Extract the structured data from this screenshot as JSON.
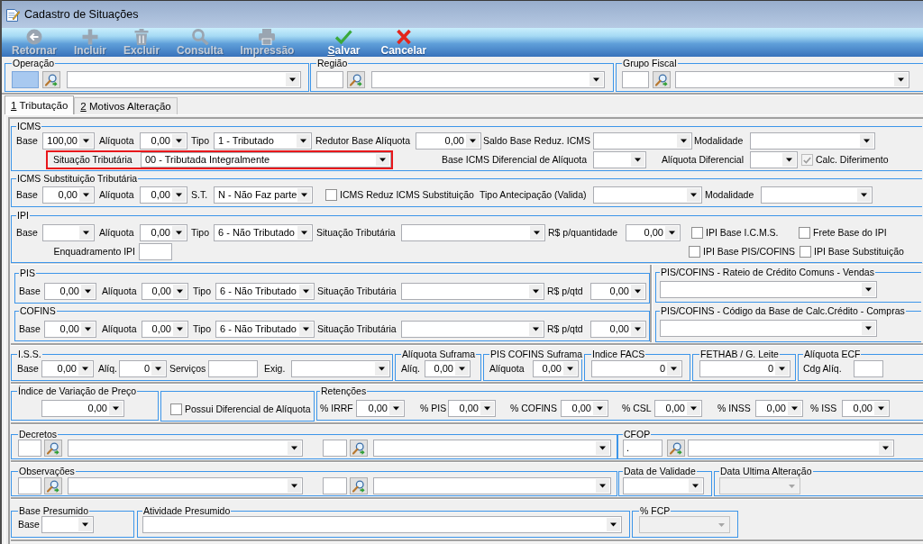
{
  "window": {
    "title": "Cadastro de Situações"
  },
  "toolbar": [
    {
      "label": "Retornar",
      "disabled": true,
      "mnemonic": false
    },
    {
      "label": "Incluir",
      "disabled": true,
      "mnemonic": false
    },
    {
      "label": "Excluir",
      "disabled": true,
      "mnemonic": false
    },
    {
      "label": "Consulta",
      "disabled": true,
      "mnemonic": false
    },
    {
      "label": "Impressão",
      "disabled": true,
      "mnemonic": false
    },
    {
      "label": "Salvar",
      "disabled": false,
      "mnemonic": true
    },
    {
      "label": "Cancelar",
      "disabled": false,
      "mnemonic": false
    }
  ],
  "header_groups": [
    {
      "legend": "Operação",
      "code_focused": true
    },
    {
      "legend": "Região",
      "code_focused": false
    },
    {
      "legend": "Grupo Fiscal",
      "code_focused": false
    }
  ],
  "tabs": [
    {
      "label": "1 Tributação",
      "mnemonic": true,
      "selected": true
    },
    {
      "label": "2 Motivos Alteração",
      "mnemonic": true,
      "selected": false
    }
  ],
  "icms": {
    "legend": "ICMS",
    "base": {
      "label": "Base",
      "value": "100,00"
    },
    "aliquota": {
      "label": "Alíquota",
      "value": "0,00"
    },
    "tipo": {
      "label": "Tipo",
      "value": "1 - Tributado"
    },
    "redutor_base_aliquota": {
      "label": "Redutor Base Alíquota",
      "value": "0,00"
    },
    "saldo_base_reduz": {
      "label": "Saldo Base Reduz. ICMS"
    },
    "modalidade": {
      "label": "Modalidade"
    },
    "situacao_tributaria": {
      "label": "Situação Tributária",
      "value": "00 - Tributada Integralmente",
      "highlighted": true
    },
    "base_diferencial": {
      "label": "Base ICMS Diferencial de Alíquota"
    },
    "aliquota_diferencial": {
      "label": "Alíquota Diferencial"
    },
    "calc_diferimento": {
      "label": "Calc. Diferimento",
      "checked": true,
      "disabled": true
    }
  },
  "icms_st": {
    "legend": "ICMS Substituição Tributária",
    "base": {
      "label": "Base",
      "value": "0,00"
    },
    "aliquota": {
      "label": "Alíquota",
      "value": "0,00"
    },
    "st": {
      "label": "S.T.",
      "value": "N - Não Faz parte"
    },
    "reduz_icms": {
      "label": "ICMS Reduz ICMS Substituição",
      "checked": false
    },
    "tipo_antecipacao": {
      "label": "Tipo Antecipação (Valida)"
    },
    "modalidade": {
      "label": "Modalidade"
    }
  },
  "ipi": {
    "legend": "IPI",
    "base": {
      "label": "Base"
    },
    "aliquota": {
      "label": "Alíquota",
      "value": "0,00"
    },
    "tipo": {
      "label": "Tipo",
      "value": "6 - Não Tributado"
    },
    "situacao_tributaria": {
      "label": "Situação Tributária"
    },
    "rs_quantidade": {
      "label": "R$ p/quantidade",
      "value": "0,00"
    },
    "enquadramento": {
      "label": "Enquadramento IPI"
    },
    "options": [
      {
        "label": "IPI Base I.C.M.S.",
        "checked": false
      },
      {
        "label": "Frete Base do IPI",
        "checked": false
      },
      {
        "label": "IPI Base PIS/COFINS",
        "checked": false
      },
      {
        "label": "IPI Base Substituição",
        "checked": false
      }
    ]
  },
  "pis": {
    "legend": "PIS",
    "base": {
      "label": "Base",
      "value": "0,00"
    },
    "aliquota": {
      "label": "Alíquota",
      "value": "0,00"
    },
    "tipo": {
      "label": "Tipo",
      "value": "6 - Não Tributado"
    },
    "situacao_tributaria": {
      "label": "Situação Tributária"
    },
    "rs_qtd": {
      "label": "R$ p/qtd",
      "value": "0,00"
    }
  },
  "cofins": {
    "legend": "COFINS",
    "base": {
      "label": "Base",
      "value": "0,00"
    },
    "aliquota": {
      "label": "Alíquota",
      "value": "0,00"
    },
    "tipo": {
      "label": "Tipo",
      "value": "6 - Não Tributado"
    },
    "situacao_tributaria": {
      "label": "Situação Tributária"
    },
    "rs_qtd": {
      "label": "R$ p/qtd",
      "value": "0,00"
    }
  },
  "pis_cofins_rateio": {
    "legend": "PIS/COFINS - Rateio de Crédito Comuns - Vendas"
  },
  "pis_cofins_codigo_base": {
    "legend": "PIS/COFINS - Código da Base de Calc.Crédito - Compras"
  },
  "iss": {
    "legend": "I.S.S.",
    "base": {
      "label": "Base",
      "value": "0,00"
    },
    "aliq": {
      "label": "Alíq.",
      "value": "0"
    },
    "servicos": {
      "label": "Serviços"
    },
    "exig": {
      "label": "Exig."
    }
  },
  "aliquota_suframa": {
    "legend": "Alíquota Suframa",
    "aliq": {
      "label": "Alíq.",
      "value": "0,00"
    }
  },
  "pis_cofins_suframa": {
    "legend": "PIS COFINS Suframa",
    "aliquota": {
      "label": "Alíquota",
      "value": "0,00"
    }
  },
  "indice_facs": {
    "legend": "Indice FACS",
    "value": "0"
  },
  "fethab": {
    "legend": "FETHAB / G. Leite",
    "value": "0"
  },
  "aliquota_ecf": {
    "legend": "Alíquota ECF",
    "cdg_aliq": {
      "label": "Cdg Alíq."
    }
  },
  "indice_variacao_preco": {
    "legend": "Índice de Variação de Preço",
    "value": "0,00"
  },
  "diferencial_aliquota": {
    "label": "Possui Diferencial de Alíquota",
    "checked": false
  },
  "retencoes": {
    "legend": "Retenções",
    "fields": [
      {
        "label": "% IRRF",
        "value": "0,00"
      },
      {
        "label": "% PIS",
        "value": "0,00"
      },
      {
        "label": "% COFINS",
        "value": "0,00"
      },
      {
        "label": "% CSL",
        "value": "0,00"
      },
      {
        "label": "% INSS",
        "value": "0,00"
      },
      {
        "label": "% ISS",
        "value": "0,00"
      }
    ]
  },
  "decretos": {
    "legend": "Decretos"
  },
  "cfop": {
    "legend": "CFOP",
    "code": "."
  },
  "observacoes": {
    "legend": "Observações"
  },
  "data_validade": {
    "legend": "Data de Validade",
    "disabled": false
  },
  "data_ultima_alteracao": {
    "legend": "Data Ultima Alteração",
    "disabled": true
  },
  "base_presumido": {
    "legend": "Base Presumido",
    "base": {
      "label": "Base"
    }
  },
  "atividade_presumido": {
    "legend": "Atividade Presumido"
  },
  "fcp": {
    "legend": "% FCP",
    "disabled": true
  }
}
